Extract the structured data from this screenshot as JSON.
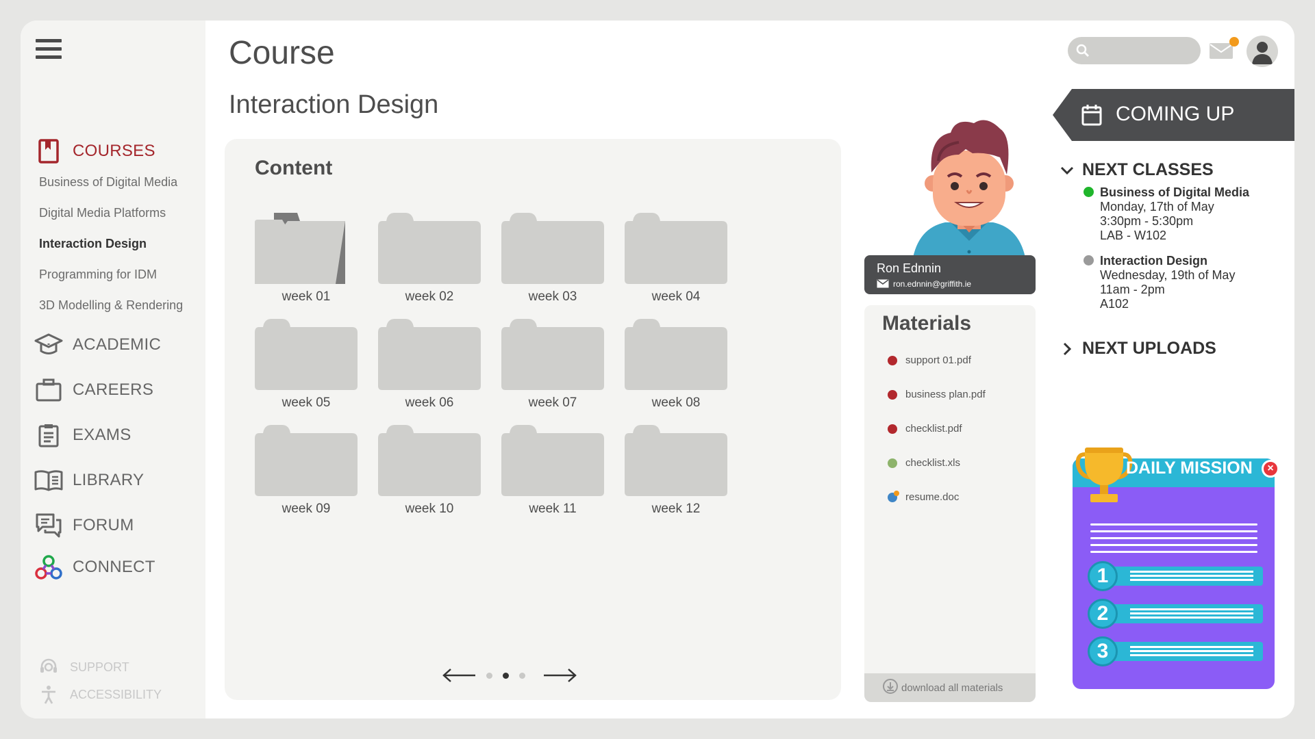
{
  "sidebar": {
    "menu_icon": "hamburger-menu-icon",
    "courses_label": "COURSES",
    "courses": [
      "Business of Digital Media",
      "Digital Media Platforms",
      "Interaction Design",
      "Programming for IDM",
      "3D Modelling & Rendering"
    ],
    "active_course": "Interaction Design",
    "nav": [
      {
        "label": "ACADEMIC",
        "icon": "graduation-cap-icon"
      },
      {
        "label": "CAREERS",
        "icon": "briefcase-icon"
      },
      {
        "label": "EXAMS",
        "icon": "clipboard-icon"
      },
      {
        "label": "LIBRARY",
        "icon": "open-book-icon"
      },
      {
        "label": "FORUM",
        "icon": "chat-bubbles-icon"
      },
      {
        "label": "CONNECT",
        "icon": "connect-icon"
      }
    ],
    "support_label": "SUPPORT",
    "accessibility_label": "ACCESSIBILITY"
  },
  "header": {
    "title": "Course",
    "subtitle": "Interaction Design",
    "search_placeholder": "",
    "notification": true
  },
  "content": {
    "title": "Content",
    "folders": [
      "week 01",
      "week 02",
      "week 03",
      "week 04",
      "week 05",
      "week 06",
      "week 07",
      "week 08",
      "week 09",
      "week 10",
      "week 11",
      "week 12"
    ],
    "open_folder": "week 01",
    "pager": {
      "pages": 3,
      "current": 2
    }
  },
  "tutor": {
    "name": "Ron Ednnin",
    "email": "ron.ednnin@griffith.ie"
  },
  "materials": {
    "title": "Materials",
    "items": [
      {
        "name": "support 01.pdf",
        "color": "#b2282d"
      },
      {
        "name": "business plan.pdf",
        "color": "#b2282d"
      },
      {
        "name": "checklist.pdf",
        "color": "#b2282d"
      },
      {
        "name": "checklist.xls",
        "color": "#8db36b"
      },
      {
        "name": "resume.doc",
        "color": "#3f86c6"
      }
    ],
    "download_label": "download all materials"
  },
  "coming_up": {
    "title": "COMING UP",
    "next_classes_label": "NEXT CLASSES",
    "classes": [
      {
        "name": "Business of Digital Media",
        "date": "Monday, 17th of May",
        "time": "3:30pm - 5:30pm",
        "room": "LAB - W102",
        "color": "#1fb52b"
      },
      {
        "name": "Interaction Design",
        "date": "Wednesday, 19th of May",
        "time": "11am - 2pm",
        "room": "A102",
        "color": "#9a9a9a"
      }
    ],
    "next_uploads_label": "NEXT UPLOADS"
  },
  "mission": {
    "title": "DAILY MISSION",
    "steps": [
      "1",
      "2",
      "3"
    ],
    "close_icon": "close-icon"
  },
  "colors": {
    "accent": "#a4262c",
    "dark_panel": "#4c4d4f",
    "mission_purple": "#8b5cf6",
    "mission_cyan": "#2bb7d6"
  }
}
